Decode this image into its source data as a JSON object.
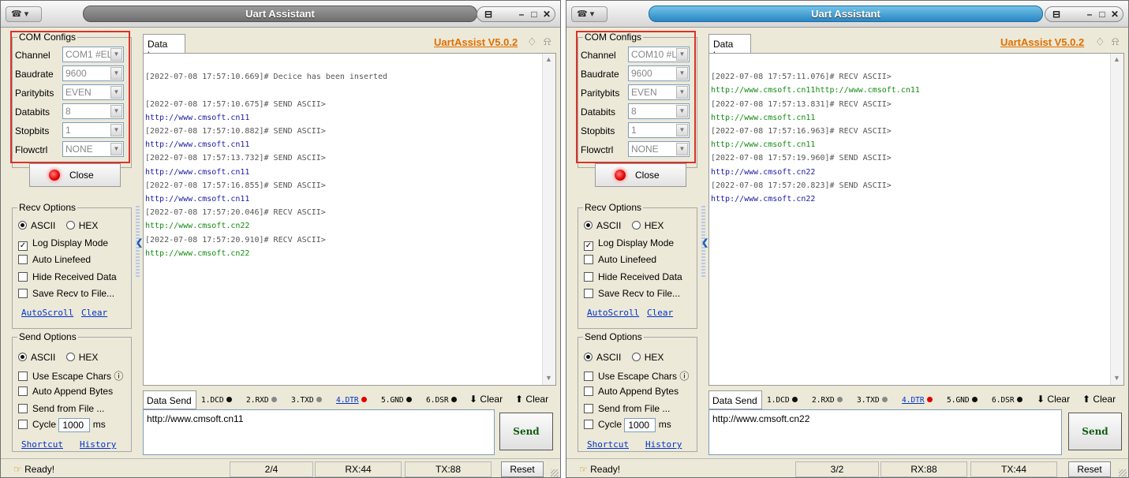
{
  "windows": [
    {
      "title": "Uart Assistant",
      "sysmenu": "☎ ▾",
      "brand": "UartAssist V5.0.2",
      "datalog_tab": "Data log",
      "com_configs": {
        "title": "COM Configs",
        "rows": [
          {
            "label": "Channel",
            "value": "COM1 #EL"
          },
          {
            "label": "Baudrate",
            "value": "9600"
          },
          {
            "label": "Paritybits",
            "value": "EVEN"
          },
          {
            "label": "Databits",
            "value": "8"
          },
          {
            "label": "Stopbits",
            "value": "1"
          },
          {
            "label": "Flowctrl",
            "value": "NONE"
          }
        ],
        "close_label": "Close"
      },
      "recv_options": {
        "title": "Recv Options",
        "ascii": "ASCII",
        "hex": "HEX",
        "log_display": "Log Display Mode",
        "auto_linefeed": "Auto Linefeed",
        "hide_received": "Hide Received Data",
        "save_to_file": "Save Recv to File...",
        "autoscroll": "AutoScroll",
        "clear": "Clear"
      },
      "send_options": {
        "title": "Send Options",
        "ascii": "ASCII",
        "hex": "HEX",
        "escape": "Use Escape Chars",
        "append": "Auto Append Bytes",
        "from_file": "Send from File ...",
        "cycle": "Cycle",
        "cycle_value": "1000",
        "cycle_unit": "ms",
        "shortcut": "Shortcut",
        "history": "History"
      },
      "log": [
        {
          "kind": "blank",
          "text": " "
        },
        {
          "kind": "sys",
          "text": "[2022-07-08 17:57:10.669]# Decice has been inserted"
        },
        {
          "kind": "blank",
          "text": " "
        },
        {
          "kind": "sys",
          "text": "[2022-07-08 17:57:10.675]# SEND ASCII>"
        },
        {
          "kind": "send",
          "text": "http://www.cmsoft.cn11"
        },
        {
          "kind": "sys",
          "text": "[2022-07-08 17:57:10.882]# SEND ASCII>"
        },
        {
          "kind": "send",
          "text": "http://www.cmsoft.cn11"
        },
        {
          "kind": "sys",
          "text": "[2022-07-08 17:57:13.732]# SEND ASCII>"
        },
        {
          "kind": "send",
          "text": "http://www.cmsoft.cn11"
        },
        {
          "kind": "sys",
          "text": "[2022-07-08 17:57:16.855]# SEND ASCII>"
        },
        {
          "kind": "send",
          "text": "http://www.cmsoft.cn11"
        },
        {
          "kind": "sys",
          "text": "[2022-07-08 17:57:20.046]# RECV ASCII>"
        },
        {
          "kind": "recv",
          "text": "http://www.cmsoft.cn22"
        },
        {
          "kind": "sys",
          "text": "[2022-07-08 17:57:20.910]# RECV ASCII>"
        },
        {
          "kind": "recv",
          "text": "http://www.cmsoft.cn22"
        }
      ],
      "send_bar": {
        "tab": "Data Send",
        "pins": [
          {
            "label": "1.DCD",
            "color": "#111111",
            "underline": false
          },
          {
            "label": "2.RXD",
            "color": "#888888",
            "underline": false
          },
          {
            "label": "3.TXD",
            "color": "#888888",
            "underline": false
          },
          {
            "label": "4.DTR",
            "color": "#e00000",
            "underline": true
          },
          {
            "label": "5.GND",
            "color": "#111111",
            "underline": false
          },
          {
            "label": "6.DSR",
            "color": "#111111",
            "underline": false
          }
        ],
        "clear1": "Clear",
        "clear2": "Clear"
      },
      "send_text": "http://www.cmsoft.cn11",
      "send_button": "Send",
      "status": {
        "ready": "Ready!",
        "counter": "2/4",
        "rx": "RX:44",
        "tx": "TX:88",
        "reset": "Reset"
      }
    },
    {
      "title": "Uart Assistant",
      "sysmenu": "☎ ▾",
      "brand": "UartAssist V5.0.2",
      "datalog_tab": "Data log",
      "com_configs": {
        "title": "COM Configs",
        "rows": [
          {
            "label": "Channel",
            "value": "COM10 #L"
          },
          {
            "label": "Baudrate",
            "value": "9600"
          },
          {
            "label": "Paritybits",
            "value": "EVEN"
          },
          {
            "label": "Databits",
            "value": "8"
          },
          {
            "label": "Stopbits",
            "value": "1"
          },
          {
            "label": "Flowctrl",
            "value": "NONE"
          }
        ],
        "close_label": "Close"
      },
      "recv_options": {
        "title": "Recv Options",
        "ascii": "ASCII",
        "hex": "HEX",
        "log_display": "Log Display Mode",
        "auto_linefeed": "Auto Linefeed",
        "hide_received": "Hide Received Data",
        "save_to_file": "Save Recv to File...",
        "autoscroll": "AutoScroll",
        "clear": "Clear"
      },
      "send_options": {
        "title": "Send Options",
        "ascii": "ASCII",
        "hex": "HEX",
        "escape": "Use Escape Chars",
        "append": "Auto Append Bytes",
        "from_file": "Send from File ...",
        "cycle": "Cycle",
        "cycle_value": "1000",
        "cycle_unit": "ms",
        "shortcut": "Shortcut",
        "history": "History"
      },
      "log": [
        {
          "kind": "blank",
          "text": " "
        },
        {
          "kind": "sys",
          "text": "[2022-07-08 17:57:11.076]# RECV ASCII>"
        },
        {
          "kind": "recv",
          "text": "http://www.cmsoft.cn11http://www.cmsoft.cn11"
        },
        {
          "kind": "sys",
          "text": "[2022-07-08 17:57:13.831]# RECV ASCII>"
        },
        {
          "kind": "recv",
          "text": "http://www.cmsoft.cn11"
        },
        {
          "kind": "sys",
          "text": "[2022-07-08 17:57:16.963]# RECV ASCII>"
        },
        {
          "kind": "recv",
          "text": "http://www.cmsoft.cn11"
        },
        {
          "kind": "sys",
          "text": "[2022-07-08 17:57:19.960]# SEND ASCII>"
        },
        {
          "kind": "send",
          "text": "http://www.cmsoft.cn22"
        },
        {
          "kind": "sys",
          "text": "[2022-07-08 17:57:20.823]# SEND ASCII>"
        },
        {
          "kind": "send",
          "text": "http://www.cmsoft.cn22"
        }
      ],
      "send_bar": {
        "tab": "Data Send",
        "pins": [
          {
            "label": "1.DCD",
            "color": "#111111",
            "underline": false
          },
          {
            "label": "2.RXD",
            "color": "#888888",
            "underline": false
          },
          {
            "label": "3.TXD",
            "color": "#888888",
            "underline": false
          },
          {
            "label": "4.DTR",
            "color": "#e00000",
            "underline": true
          },
          {
            "label": "5.GND",
            "color": "#111111",
            "underline": false
          },
          {
            "label": "6.DSR",
            "color": "#111111",
            "underline": false
          }
        ],
        "clear1": "Clear",
        "clear2": "Clear"
      },
      "send_text": "http://www.cmsoft.cn22",
      "send_button": "Send",
      "status": {
        "ready": "Ready!",
        "counter": "3/2",
        "rx": "RX:88",
        "tx": "TX:44",
        "reset": "Reset"
      }
    }
  ]
}
